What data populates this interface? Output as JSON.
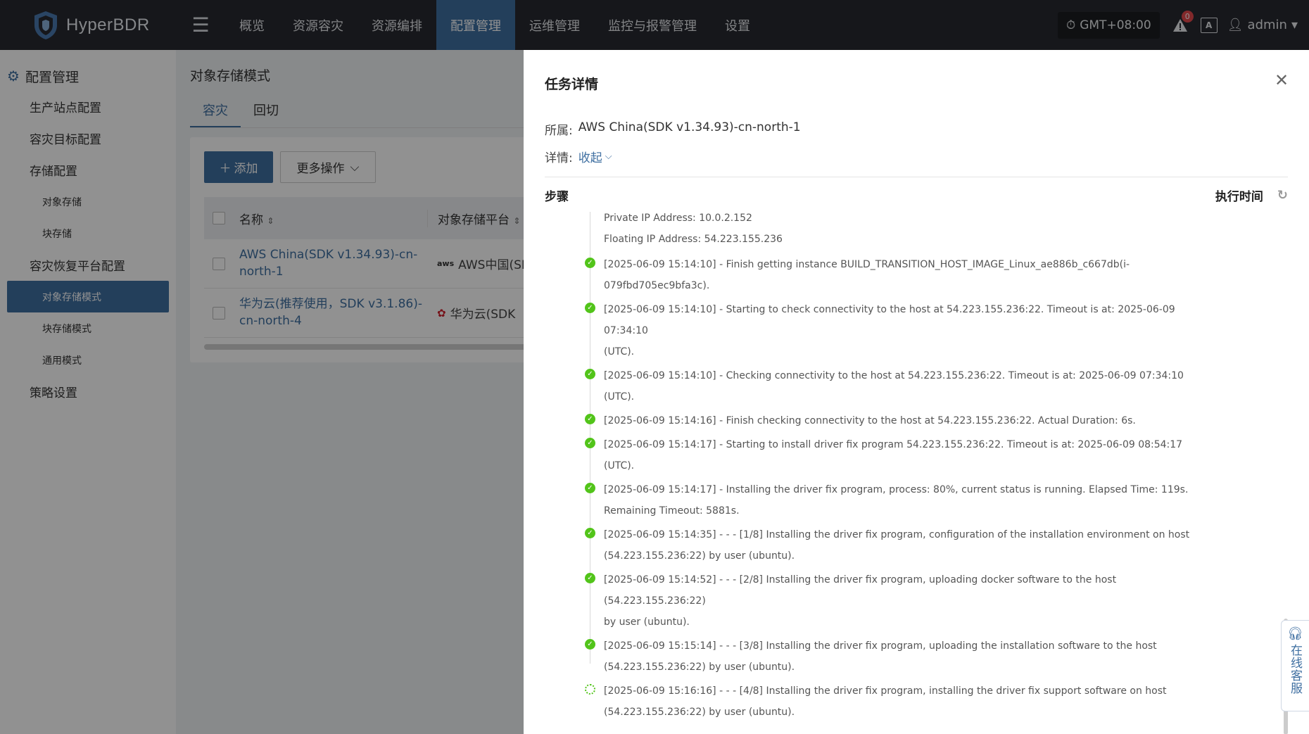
{
  "app": {
    "name": "HyperBDR"
  },
  "topnav": {
    "items": [
      {
        "label": "概览",
        "active": false
      },
      {
        "label": "资源容灾",
        "active": false
      },
      {
        "label": "资源编排",
        "active": false
      },
      {
        "label": "配置管理",
        "active": true
      },
      {
        "label": "运维管理",
        "active": false
      },
      {
        "label": "监控与报警管理",
        "active": false
      },
      {
        "label": "设置",
        "active": false
      }
    ],
    "timezone": "GMT+08:00",
    "alert_count": "0",
    "user": "admin"
  },
  "sidebar": {
    "group_title": "配置管理",
    "items": [
      {
        "label": "生产站点配置",
        "level": 1
      },
      {
        "label": "容灾目标配置",
        "level": 1
      },
      {
        "label": "存储配置",
        "level": 1
      },
      {
        "label": "对象存储",
        "level": 2
      },
      {
        "label": "块存储",
        "level": 2
      },
      {
        "label": "容灾恢复平台配置",
        "level": 1
      },
      {
        "label": "对象存储模式",
        "level": 2,
        "active": true
      },
      {
        "label": "块存储模式",
        "level": 2
      },
      {
        "label": "通用模式",
        "level": 2
      },
      {
        "label": "策略设置",
        "level": 1
      }
    ]
  },
  "main": {
    "title": "对象存储模式",
    "tabs": [
      {
        "label": "容灾",
        "active": true
      },
      {
        "label": "回切",
        "active": false
      }
    ],
    "add_button": "添加",
    "more_button": "更多操作",
    "table": {
      "columns": [
        "名称",
        "对象存储平台"
      ],
      "rows": [
        {
          "name": "AWS China(SDK v1.34.93)-cn-north-1",
          "platform": "AWS中国(SD"
        },
        {
          "name": "华为云(推荐使用，SDK v3.1.86)-cn-north-4",
          "platform": "华为云(SDK"
        }
      ]
    }
  },
  "drawer": {
    "title": "任务详情",
    "belongs_label": "所属:",
    "belongs_value": "AWS China(SDK v1.34.93)-cn-north-1",
    "details_label": "详情:",
    "collapse_label": "收起",
    "steps_label": "步骤",
    "time_label": "执行时间",
    "steps": [
      {
        "status": "none",
        "lines": [
          "Private IP Address: 10.0.2.152",
          "Floating IP Address: 54.223.155.236"
        ]
      },
      {
        "status": "success",
        "lines": [
          "[2025-06-09 15:14:10] - Finish getting instance BUILD_TRANSITION_HOST_IMAGE_Linux_ae886b_c667db(i-",
          "079fbd705ec9bfa3c)."
        ]
      },
      {
        "status": "success",
        "lines": [
          "[2025-06-09 15:14:10] - Starting to check connectivity to the host at 54.223.155.236:22. Timeout is at: 2025-06-09 07:34:10",
          "(UTC)."
        ]
      },
      {
        "status": "success",
        "lines": [
          "[2025-06-09 15:14:10] - Checking connectivity to the host at 54.223.155.236:22. Timeout is at: 2025-06-09 07:34:10 (UTC)."
        ]
      },
      {
        "status": "success",
        "lines": [
          "[2025-06-09 15:14:16] - Finish checking connectivity to the host at 54.223.155.236:22. Actual Duration: 6s."
        ]
      },
      {
        "status": "success",
        "lines": [
          "[2025-06-09 15:14:17] - Starting to install driver fix program 54.223.155.236:22. Timeout is at: 2025-06-09 08:54:17 (UTC)."
        ]
      },
      {
        "status": "success",
        "lines": [
          "[2025-06-09 15:14:17] - Installing the driver fix program, process: 80%, current status is running. Elapsed Time: 119s.",
          "Remaining Timeout: 5881s."
        ]
      },
      {
        "status": "success",
        "lines": [
          "[2025-06-09 15:14:35] - - - [1/8] Installing the driver fix program, configuration of the installation environment on host",
          "(54.223.155.236:22) by user (ubuntu)."
        ]
      },
      {
        "status": "success",
        "lines": [
          "[2025-06-09 15:14:52] - - - [2/8] Installing the driver fix program, uploading docker software to the host (54.223.155.236:22)",
          "by user (ubuntu)."
        ]
      },
      {
        "status": "success",
        "lines": [
          "[2025-06-09 15:15:14] - - - [3/8] Installing the driver fix program, uploading the installation software to the host",
          "(54.223.155.236:22) by user (ubuntu)."
        ]
      },
      {
        "status": "loading",
        "lines": [
          "[2025-06-09 15:16:16] - - - [4/8] Installing the driver fix program, installing the driver fix support software on host",
          "(54.223.155.236:22) by user (ubuntu)."
        ]
      }
    ]
  },
  "chat_widget": {
    "label": "在线客服"
  },
  "colors": {
    "primary": "#3f6fa1",
    "topbar": "#272a30",
    "success": "#52c41a",
    "badge": "#e5484d"
  }
}
